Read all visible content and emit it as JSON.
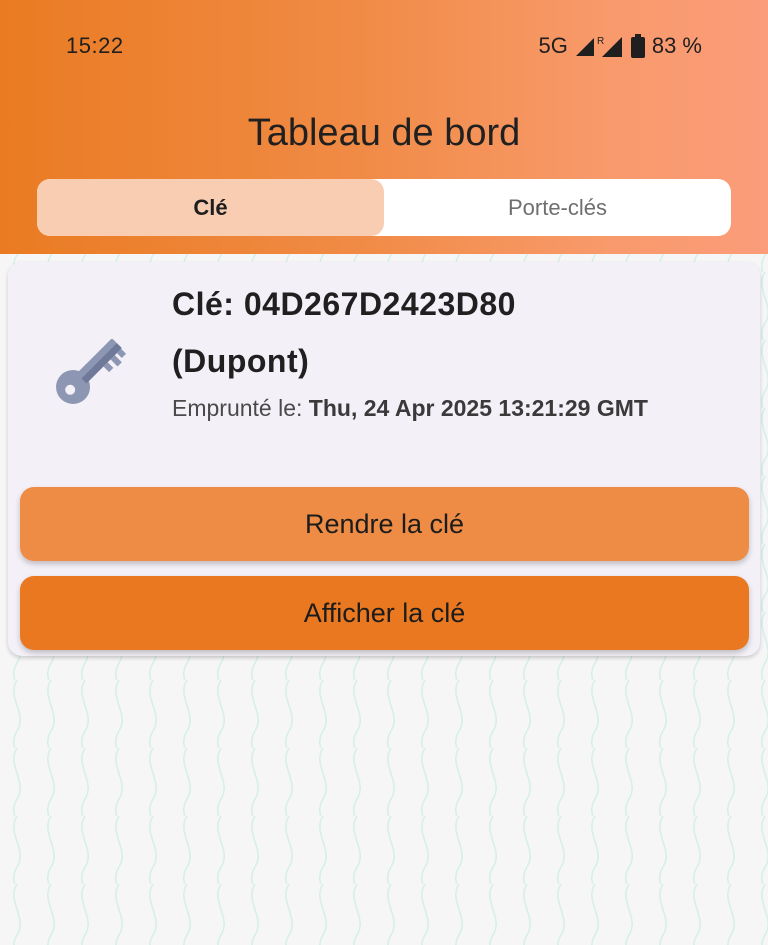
{
  "status_bar": {
    "time": "15:22",
    "network": "5G",
    "roaming_mark": "R",
    "battery": "83 %"
  },
  "header": {
    "title": "Tableau de bord"
  },
  "tabs": [
    {
      "label": "Clé",
      "active": true
    },
    {
      "label": "Porte-clés",
      "active": false
    }
  ],
  "key_card": {
    "icon": "key-icon",
    "title_prefix": "Clé:",
    "key_id": "04D267D2423D80",
    "owner": "(Dupont)",
    "borrowed_label": "Emprunté le:",
    "borrowed_date": "Thu, 24 Apr 2025 13:21:29 GMT",
    "return_button": "Rendre la clé",
    "show_button": "Afficher la clé"
  },
  "colors": {
    "header_start": "#ea7b22",
    "header_end": "#fb9c7a",
    "active_tab": "#f8cdb2",
    "return_button": "#ee8c46",
    "show_button": "#e97820",
    "card_background": "#f4f0f8",
    "key_icon": "#8d97b3"
  }
}
